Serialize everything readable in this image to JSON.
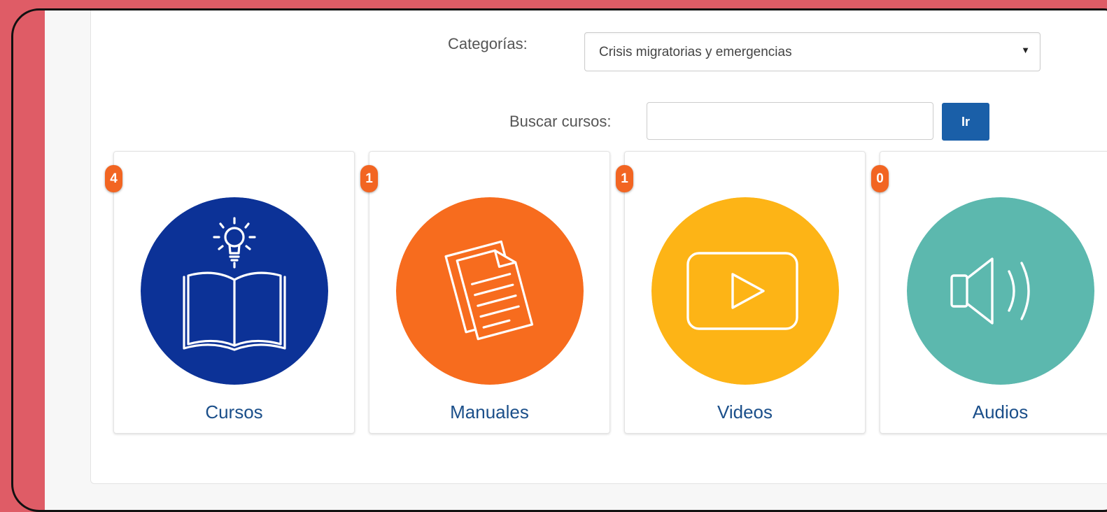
{
  "filters": {
    "category_label": "Categorías:",
    "category_value": "Crisis migratorias y emergencias",
    "search_label": "Buscar cursos:",
    "search_value": "",
    "search_button": "Ir"
  },
  "cards": [
    {
      "label": "Cursos",
      "count": "4",
      "color": "#0c3297",
      "icon": "book-lightbulb-icon"
    },
    {
      "label": "Manuales",
      "count": "1",
      "color": "#f76c1e",
      "icon": "documents-icon"
    },
    {
      "label": "Videos",
      "count": "1",
      "color": "#fdb416",
      "icon": "play-video-icon"
    },
    {
      "label": "Audios",
      "count": "0",
      "color": "#5cb8ae",
      "icon": "speaker-icon"
    }
  ],
  "colors": {
    "badge": "#f26522",
    "link": "#1b4f8a",
    "button": "#1a5fa8",
    "background": "#df5c66"
  }
}
